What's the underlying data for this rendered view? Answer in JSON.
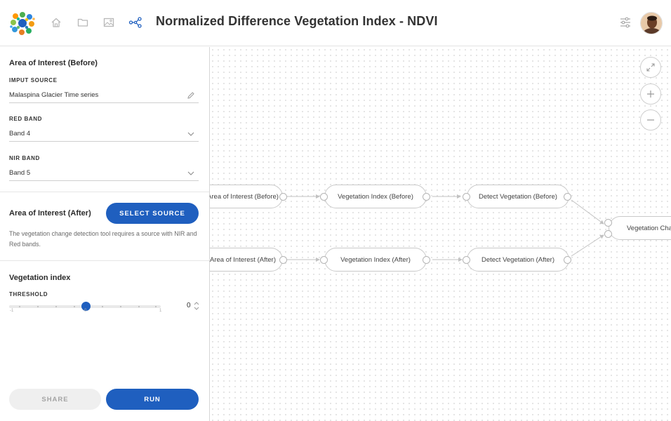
{
  "header": {
    "title": "Normalized Difference Vegetation Index - NDVI",
    "nav_icons": [
      "home-icon",
      "folder-icon",
      "image-icon",
      "workflow-icon"
    ],
    "active_nav": "workflow-icon"
  },
  "sidebar": {
    "before": {
      "title": "Area of Interest (Before)",
      "input_source_label": "IMPUT SOURCE",
      "input_source_value": "Malaspina Glacier Time series",
      "red_band_label": "RED BAND",
      "red_band_value": "Band 4",
      "nir_band_label": "NIR BAND",
      "nir_band_value": "Band 5"
    },
    "after": {
      "title": "Area of Interest (After)",
      "select_source_label": "SELECT SOURCE",
      "description": "The vegetation change detection tool requires a source with NIR and Red bands."
    },
    "vegetation": {
      "title": "Vegetation index",
      "threshold_label": "THRESHOLD",
      "threshold_value": "0",
      "threshold_min": "-1",
      "threshold_mid": "0",
      "threshold_max": "1",
      "threshold_fraction": 0.5
    },
    "share_label": "SHARE",
    "run_label": "RUN"
  },
  "canvas": {
    "nodes": {
      "aoi_before": "Area of Interest (Before)",
      "veg_before": "Vegetation Index (Before)",
      "detect_before": "Detect Vegetation (Before)",
      "aoi_after": "Area of Interest (After)",
      "veg_after": "Vegetation Index (After)",
      "detect_after": "Detect Vegetation (After)",
      "veg_change": "Vegetation Change"
    },
    "controls": [
      "expand-icon",
      "zoom-in-icon",
      "zoom-out-icon"
    ]
  },
  "colors": {
    "accent": "#1f5fbf",
    "disabled_bg": "#efefef",
    "node_border": "#c9c9c9"
  }
}
